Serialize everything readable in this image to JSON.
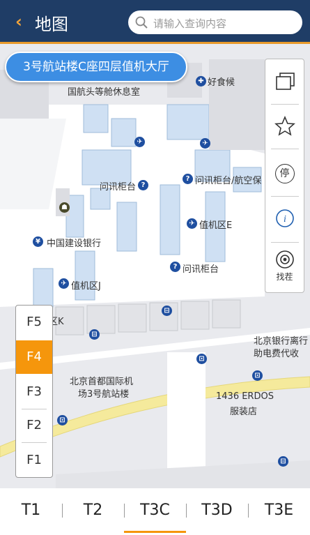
{
  "header": {
    "title": "地图",
    "back_glyph": "‹",
    "search_placeholder": "请输入查询内容"
  },
  "location_chip": "3号航站楼C座四层值机大厅",
  "tools": [
    {
      "icon": "layers-icon",
      "label": ""
    },
    {
      "icon": "star-icon",
      "label": ""
    },
    {
      "icon": "parking-icon",
      "label": ""
    },
    {
      "icon": "info-icon",
      "label": ""
    },
    {
      "icon": "locate-icon",
      "label": "找茬"
    }
  ],
  "parking_glyph": "停",
  "map_labels": [
    "好食候",
    "国航头等舱休息室",
    "问讯柜台",
    "问讯柜台/航空保",
    "中国建设银行",
    "值机区E",
    "问讯柜台",
    "值机区J",
    "值机区K",
    "北京银行离行",
    "助电费代收",
    "北京首都国际机",
    "场3号航站楼",
    "1436 ERDOS",
    "服装店"
  ],
  "floors": [
    "F5",
    "F4",
    "F3",
    "F2",
    "F1"
  ],
  "active_floor": "F4",
  "terminals": [
    "T1",
    "T2",
    "T3C",
    "T3D",
    "T3E"
  ],
  "active_terminal": "T3C",
  "colors": {
    "header": "#1f3d66",
    "accent": "#f5960c",
    "chip": "#3d8ee3",
    "road": "#f5ea9c"
  }
}
